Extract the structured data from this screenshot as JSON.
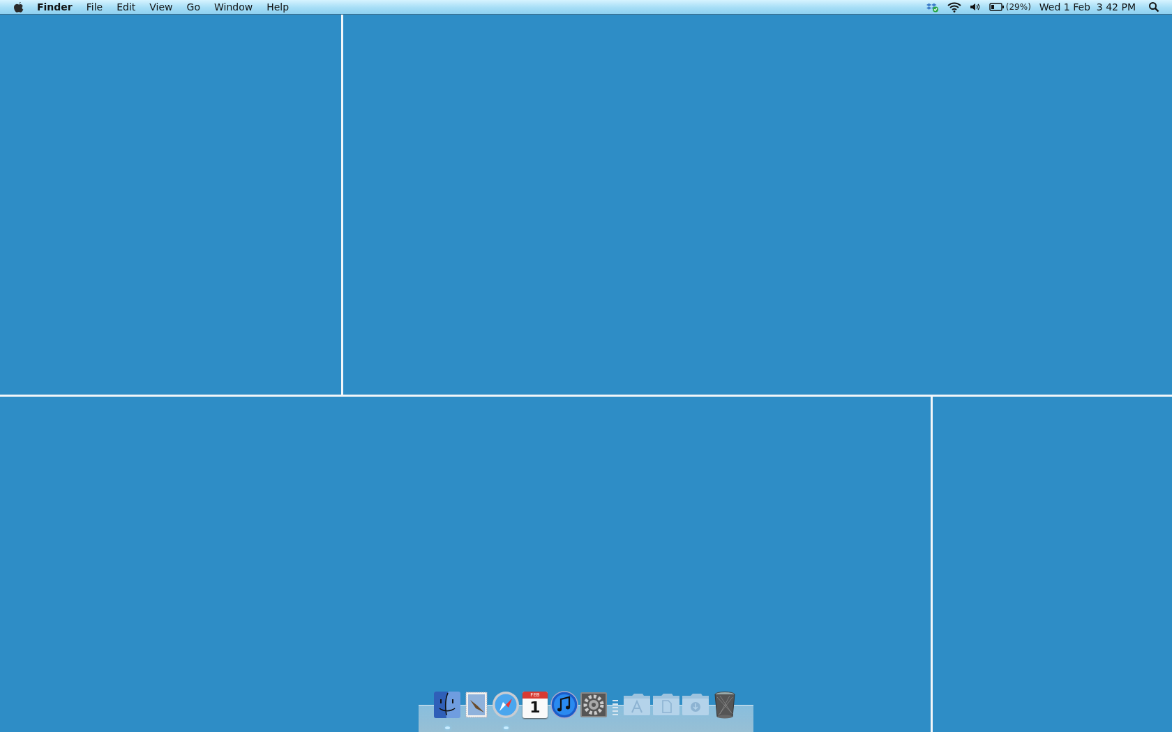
{
  "menu_bar": {
    "app_name": "Finder",
    "menus": [
      "File",
      "Edit",
      "View",
      "Go",
      "Window",
      "Help"
    ],
    "status_items": [
      {
        "kind": "dropbox"
      },
      {
        "kind": "wifi"
      },
      {
        "kind": "volume"
      },
      {
        "kind": "battery",
        "text": "(29%)"
      }
    ],
    "clock": "Wed 1 Feb  3 42 PM"
  },
  "dock": {
    "items": [
      {
        "kind": "finder",
        "running": true
      },
      {
        "kind": "mail",
        "running": false
      },
      {
        "kind": "safari",
        "running": true
      },
      {
        "kind": "calendar",
        "running": false,
        "month": "FEB",
        "day": "1"
      },
      {
        "kind": "itunes",
        "running": false
      },
      {
        "kind": "preferences",
        "running": false
      },
      {
        "kind": "separator"
      },
      {
        "kind": "applications-folder"
      },
      {
        "kind": "documents-folder"
      },
      {
        "kind": "downloads-folder"
      },
      {
        "kind": "trash"
      }
    ]
  }
}
